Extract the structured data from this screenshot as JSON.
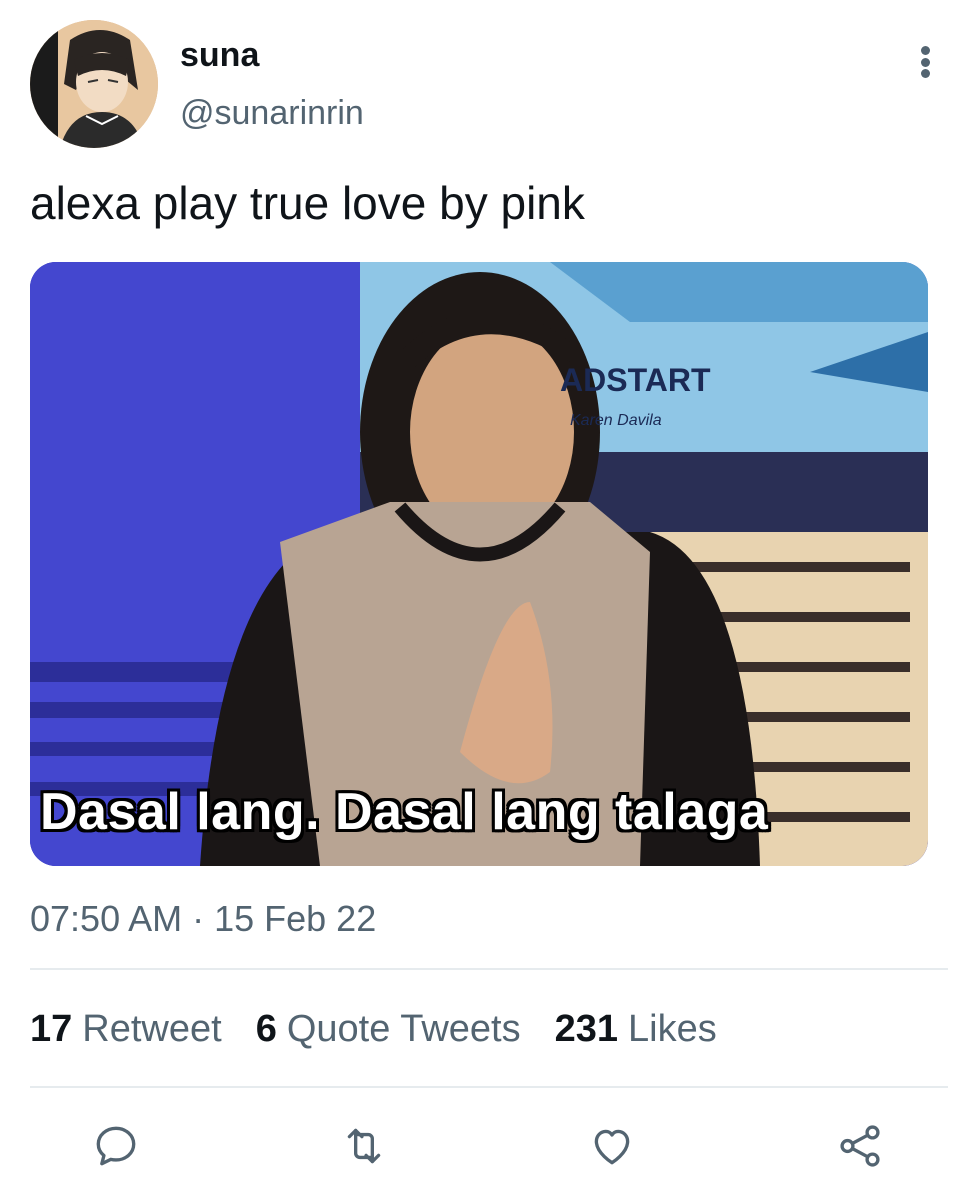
{
  "user": {
    "display_name": "suna",
    "handle": "@sunarinrin"
  },
  "tweet": {
    "text": "alexa play true love by pink",
    "media_caption": "Dasal lang. Dasal lang talaga",
    "media_banner": "ADSTART",
    "media_banner_sub": "Karen Davila",
    "timestamp": "07:50 AM · 15 Feb 22"
  },
  "stats": {
    "retweets_count": "17",
    "retweets_label": "Retweet",
    "quotes_count": "6",
    "quotes_label": "Quote Tweets",
    "likes_count": "231",
    "likes_label": "Likes"
  },
  "actions": {
    "icons": [
      "reply-icon",
      "retweet-icon",
      "like-icon",
      "share-icon"
    ]
  },
  "colors": {
    "text_primary": "#0f1419",
    "text_secondary": "#536471",
    "divider": "#e6ebee"
  }
}
